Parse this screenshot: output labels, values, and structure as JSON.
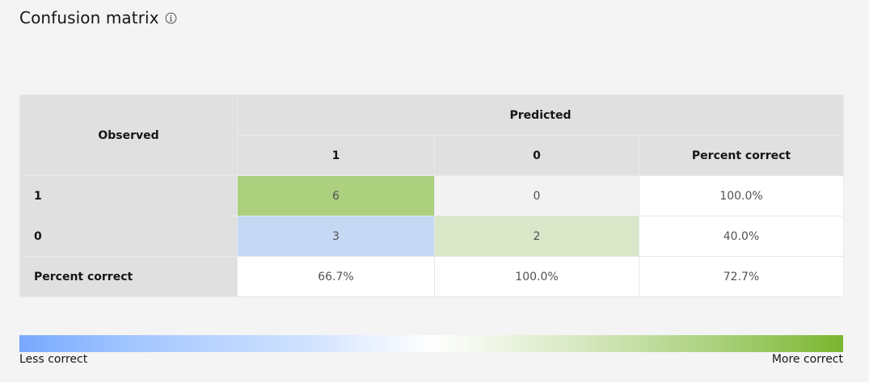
{
  "title": "Confusion matrix",
  "icons": {
    "info": "info-icon"
  },
  "matrix": {
    "observed_header": "Observed",
    "predicted_header": "Predicted",
    "columns": [
      "1",
      "0",
      "Percent correct"
    ],
    "rows": [
      {
        "label": "1",
        "cells": [
          {
            "value": "6",
            "color": "#acd07e"
          },
          {
            "value": "0",
            "color": "#f2f2f2"
          },
          {
            "value": "100.0%",
            "color": "#ffffff"
          }
        ]
      },
      {
        "label": "0",
        "cells": [
          {
            "value": "3",
            "color": "#c5d8f4"
          },
          {
            "value": "2",
            "color": "#d9e6c8"
          },
          {
            "value": "40.0%",
            "color": "#ffffff"
          }
        ]
      },
      {
        "label": "Percent correct",
        "cells": [
          {
            "value": "66.7%",
            "color": "#ffffff"
          },
          {
            "value": "100.0%",
            "color": "#ffffff"
          },
          {
            "value": "72.7%",
            "color": "#ffffff"
          }
        ]
      }
    ]
  },
  "legend": {
    "low_label": "Less correct",
    "high_label": "More correct",
    "low_color": "#78a9ff",
    "high_color": "#7ab62f"
  }
}
